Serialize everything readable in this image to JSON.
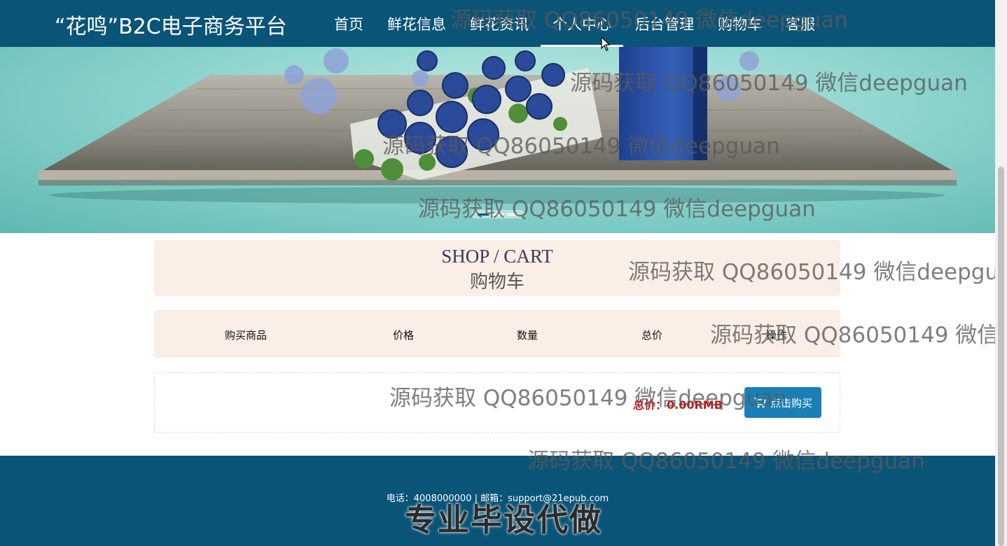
{
  "header": {
    "brand": "“花鸣”B2C电子商务平台",
    "nav": [
      "首页",
      "鲜花信息",
      "鲜花资讯",
      "个人中心",
      "后台管理",
      "购物车",
      "客服"
    ],
    "active_nav": "个人中心"
  },
  "banner": {
    "slides": 3,
    "active_slide": 1
  },
  "cart": {
    "title_en": "SHOP / CART",
    "title_zh": "购物车",
    "columns": [
      "购买商品",
      "价格",
      "数量",
      "总价",
      "操作"
    ],
    "total_text": "总价：0.00RMB",
    "buy_button": "点击购买"
  },
  "footer": {
    "contact": "电话：4008000000 | 邮箱：support@21epub.com",
    "stamp": "专业毕设代做"
  },
  "watermark": {
    "text": "源码获取 QQ86050149 微信deepguan"
  },
  "colors": {
    "header_bg": "#0a5478",
    "panel_bg": "#fbeee6",
    "total_color": "#c4161c",
    "button_bg": "#1a7fb5"
  },
  "icons": [
    "cart-icon",
    "mouse-cursor-icon"
  ]
}
